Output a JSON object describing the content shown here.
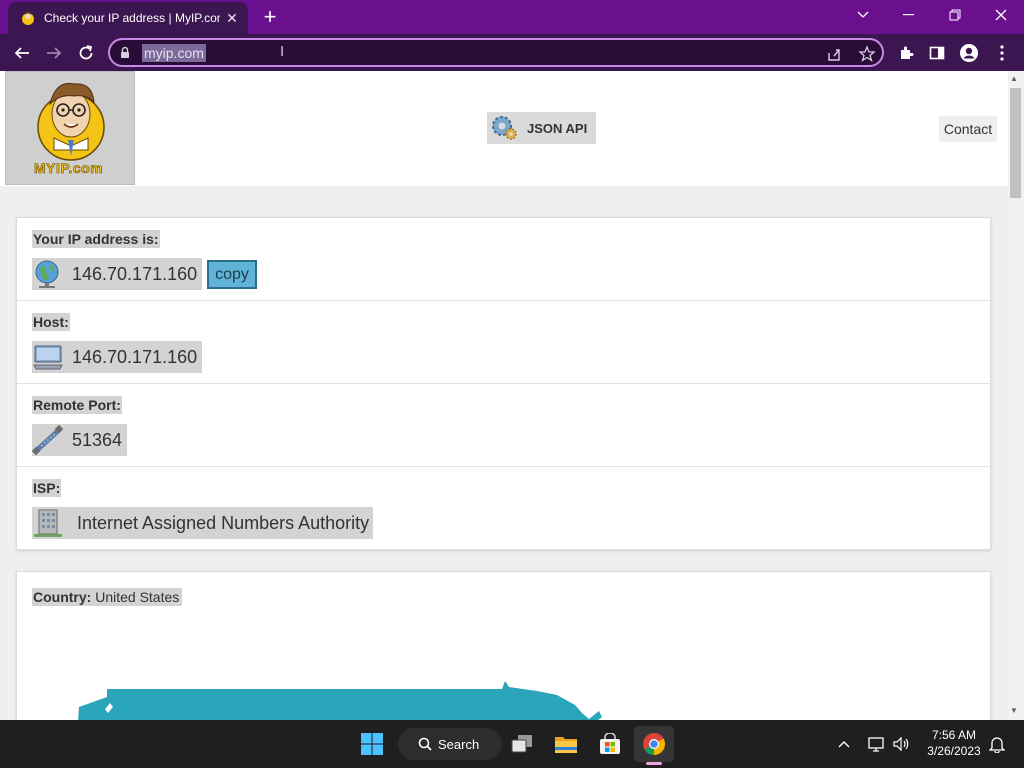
{
  "browser": {
    "tab_title": "Check your IP address | MyIP.com",
    "url": "myip.com",
    "theme_color": "#6a0f8e"
  },
  "header": {
    "logo_text": "MYIP.com",
    "json_api_label": "JSON API",
    "contact_label": "Contact"
  },
  "ip_card": {
    "ip_label": "Your IP address is:",
    "ip_value": "146.70.171.160",
    "copy_label": "copy",
    "host_label": "Host:",
    "host_value": "146.70.171.160",
    "port_label": "Remote Port:",
    "port_value": "51364",
    "isp_label": "ISP:",
    "isp_value": "Internet Assigned Numbers Authority"
  },
  "country_card": {
    "country_label": "Country:",
    "country_value": "United States",
    "map_color": "#2aa5b9"
  },
  "taskbar": {
    "search_label": "Search",
    "time": "7:56 AM",
    "date": "3/26/2023"
  }
}
